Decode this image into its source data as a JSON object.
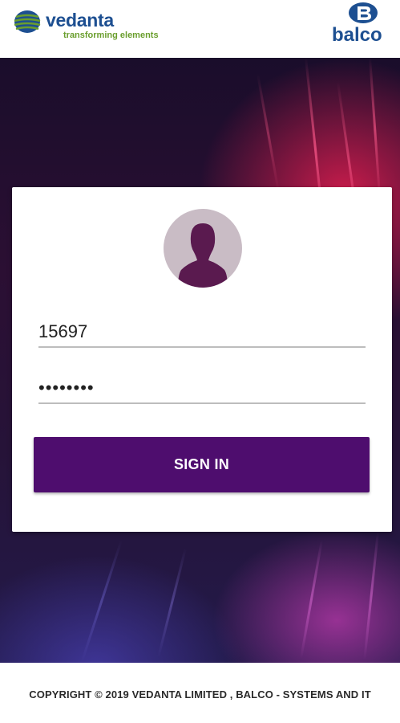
{
  "header": {
    "vedanta_logo": {
      "name": "vedanta",
      "tagline": "transforming elements"
    },
    "balco_logo": {
      "name": "balco"
    }
  },
  "login": {
    "username": {
      "value": "15697"
    },
    "password": {
      "value": "••••••••"
    },
    "signin_label": "SIGN IN"
  },
  "footer": {
    "copyright": "COPYRIGHT © 2019  VEDANTA LIMITED , BALCO - SYSTEMS AND IT"
  },
  "colors": {
    "brand_blue": "#1d4f91",
    "brand_green": "#6a9e2d",
    "button_purple": "#4e0d6e",
    "avatar_bg": "#c9bcc5",
    "avatar_silhouette": "#5a1a4f"
  },
  "icons": {
    "avatar": "person-silhouette-icon",
    "vedanta": "globe-icon",
    "balco": "balco-emblem-icon"
  }
}
